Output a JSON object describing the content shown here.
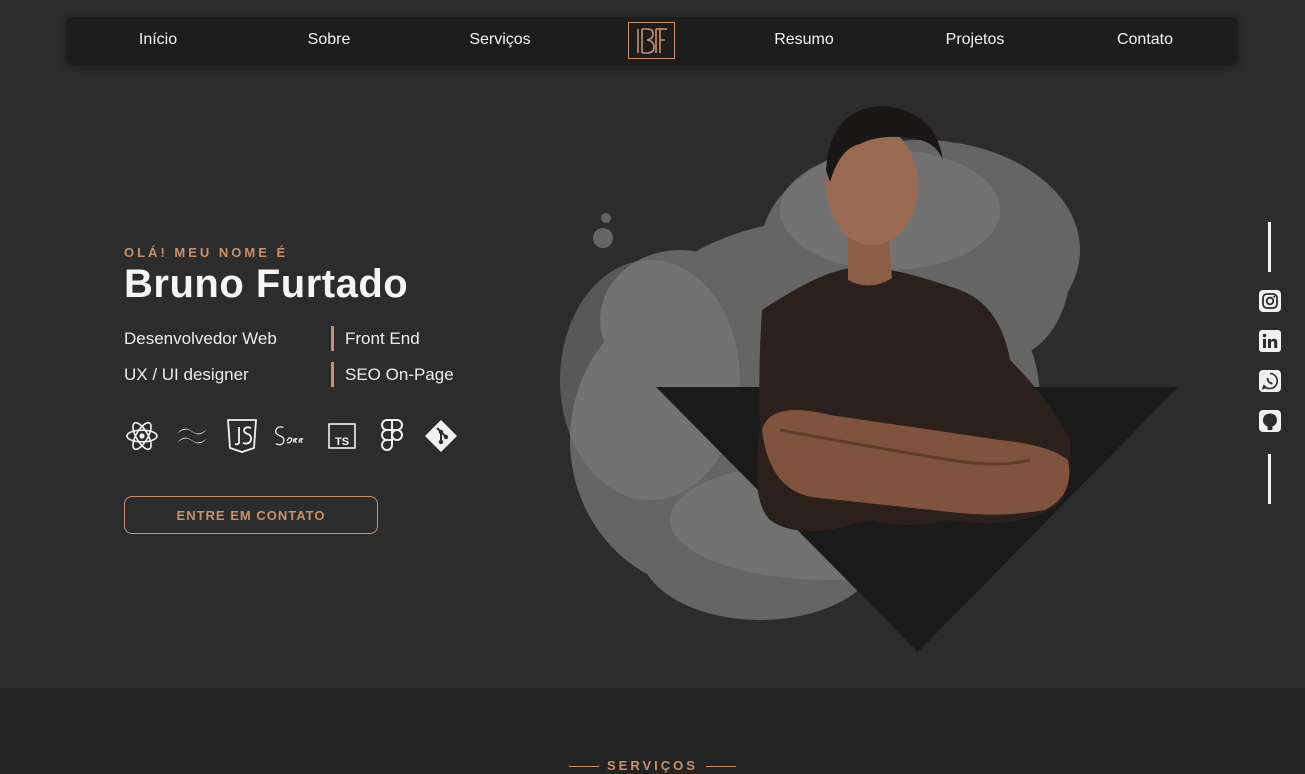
{
  "nav": {
    "items": [
      "Início",
      "Sobre",
      "Serviços",
      "Resumo",
      "Projetos",
      "Contato"
    ],
    "logo_text": "BF"
  },
  "hero": {
    "greeting": "OLÁ! MEU NOME É",
    "name": "Bruno Furtado",
    "roles": [
      "Desenvolvedor Web",
      "Front End",
      "UX / UI designer",
      "SEO On-Page"
    ],
    "tech_icons": [
      "react-icon",
      "tailwind-icon",
      "javascript-icon",
      "sass-icon",
      "typescript-icon",
      "figma-icon",
      "git-icon"
    ],
    "cta_label": "ENTRE EM CONTATO"
  },
  "social": {
    "icons": [
      "instagram-icon",
      "linkedin-icon",
      "whatsapp-icon",
      "github-icon"
    ]
  },
  "services": {
    "title": "SERVIÇOS"
  },
  "colors": {
    "accent": "#c9916b",
    "background": "#2c2c2c",
    "nav_bg": "#1d1d1d",
    "section_bg": "#232323"
  }
}
